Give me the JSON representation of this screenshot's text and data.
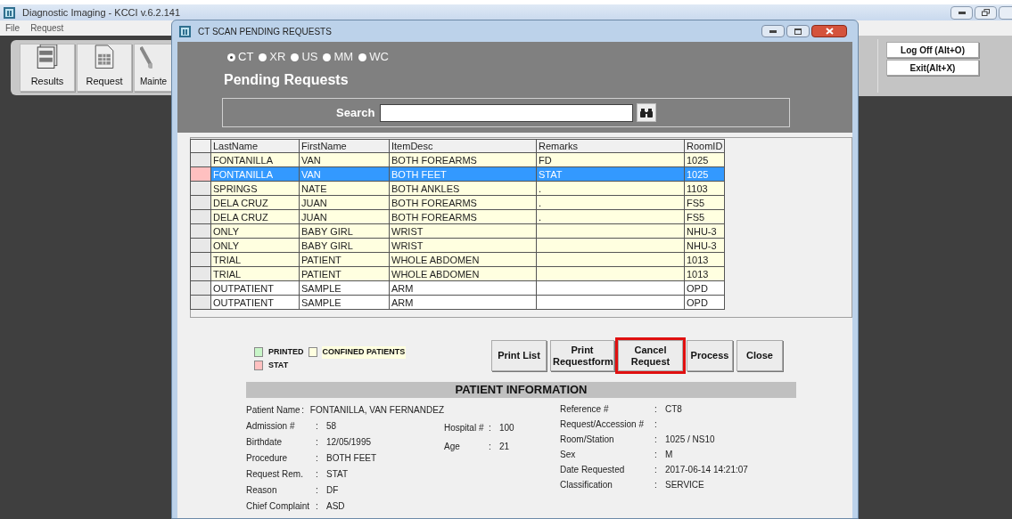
{
  "app_window": {
    "title": "Diagnostic Imaging - KCCI v.6.2.141"
  },
  "menu": [
    "File",
    "Request"
  ],
  "toolbar": [
    {
      "label": "Results",
      "kind": "results"
    },
    {
      "label": "Request",
      "kind": "request"
    },
    {
      "label": "Mainte",
      "kind": "maintenance"
    }
  ],
  "session_buttons": [
    "Log Off (Alt+O)",
    "Exit(Alt+X)"
  ],
  "dialog": {
    "title": "CT SCAN PENDING REQUESTS",
    "modalities": [
      {
        "label": "CT",
        "selected": true
      },
      {
        "label": "XR",
        "selected": false
      },
      {
        "label": "US",
        "selected": false
      },
      {
        "label": "MM",
        "selected": false
      },
      {
        "label": "WC",
        "selected": false
      }
    ],
    "heading": "Pending Requests",
    "search": {
      "label": "Search"
    },
    "table": {
      "columns": [
        "LastName",
        "FirstName",
        "ItemDesc",
        "Remarks",
        "RoomID"
      ],
      "rows": [
        {
          "cells": [
            "FONTANILLA",
            "VAN",
            "BOTH FOREARMS",
            "FD",
            "1025"
          ],
          "kind": "confined",
          "stat": false,
          "selected": false
        },
        {
          "cells": [
            "FONTANILLA",
            "VAN",
            "BOTH FEET",
            "STAT",
            "1025"
          ],
          "kind": "confined",
          "stat": true,
          "selected": true
        },
        {
          "cells": [
            "SPRINGS",
            "NATE",
            "BOTH ANKLES",
            ".",
            "1103"
          ],
          "kind": "confined",
          "stat": false,
          "selected": false
        },
        {
          "cells": [
            "DELA CRUZ",
            "JUAN",
            "BOTH FOREARMS",
            ".",
            "FS5"
          ],
          "kind": "confined",
          "stat": false,
          "selected": false
        },
        {
          "cells": [
            "DELA CRUZ",
            "JUAN",
            "BOTH FOREARMS",
            ".",
            "FS5"
          ],
          "kind": "confined",
          "stat": false,
          "selected": false
        },
        {
          "cells": [
            "ONLY",
            "BABY GIRL",
            "WRIST",
            "",
            "NHU-3"
          ],
          "kind": "confined",
          "stat": false,
          "selected": false
        },
        {
          "cells": [
            "ONLY",
            "BABY GIRL",
            "WRIST",
            "",
            "NHU-3"
          ],
          "kind": "confined",
          "stat": false,
          "selected": false
        },
        {
          "cells": [
            "TRIAL",
            "PATIENT",
            "WHOLE ABDOMEN",
            "",
            "1013"
          ],
          "kind": "confined",
          "stat": false,
          "selected": false
        },
        {
          "cells": [
            "TRIAL",
            "PATIENT",
            "WHOLE ABDOMEN",
            "",
            "1013"
          ],
          "kind": "confined",
          "stat": false,
          "selected": false
        },
        {
          "cells": [
            "OUTPATIENT",
            "SAMPLE",
            "ARM",
            "",
            "OPD"
          ],
          "kind": "outpatient",
          "stat": false,
          "selected": false
        },
        {
          "cells": [
            "OUTPATIENT",
            "SAMPLE",
            "ARM",
            "",
            "OPD"
          ],
          "kind": "outpatient",
          "stat": false,
          "selected": false
        }
      ]
    },
    "legend": [
      {
        "label": "PRINTED",
        "color": "#c8f5c8"
      },
      {
        "label": "CONFINED PATIENTS",
        "color": "#ffffe0"
      },
      {
        "label": "STAT",
        "color": "#ffc0c0"
      }
    ],
    "buttons": [
      {
        "label": "Print List",
        "highlighted": false
      },
      {
        "label": "Print Requestform",
        "highlighted": false
      },
      {
        "label": "Cancel Request",
        "highlighted": true
      },
      {
        "label": "Process",
        "highlighted": false
      },
      {
        "label": "Close",
        "highlighted": false
      }
    ],
    "patient_info": {
      "title": "PATIENT INFORMATION",
      "separator": ":",
      "left": [
        {
          "label": "Patient Name",
          "value": "FONTANILLA, VAN FERNANDEZ"
        },
        {
          "label": "Admission #",
          "value": "58"
        },
        {
          "label": "Birthdate",
          "value": "12/05/1995"
        },
        {
          "label": "Procedure",
          "value": "BOTH FEET"
        },
        {
          "label": "Request Rem.",
          "value": "STAT"
        },
        {
          "label": "Reason",
          "value": "DF"
        },
        {
          "label": "Chief Complaint",
          "value": "ASD"
        }
      ],
      "middle": [
        {
          "label": "Hospital #",
          "value": "100"
        },
        {
          "label": "Age",
          "value": "21"
        }
      ],
      "right": [
        {
          "label": "Reference #",
          "value": "CT8"
        },
        {
          "label": "Request/Accession #"
        },
        {
          "label": "Room/Station",
          "value": "1025 / NS10"
        },
        {
          "label": "Sex",
          "value": "M"
        },
        {
          "label": "Date Requested",
          "value": "2017-06-14 14:21:07"
        },
        {
          "label": "Classification",
          "value": "SERVICE"
        }
      ]
    }
  }
}
